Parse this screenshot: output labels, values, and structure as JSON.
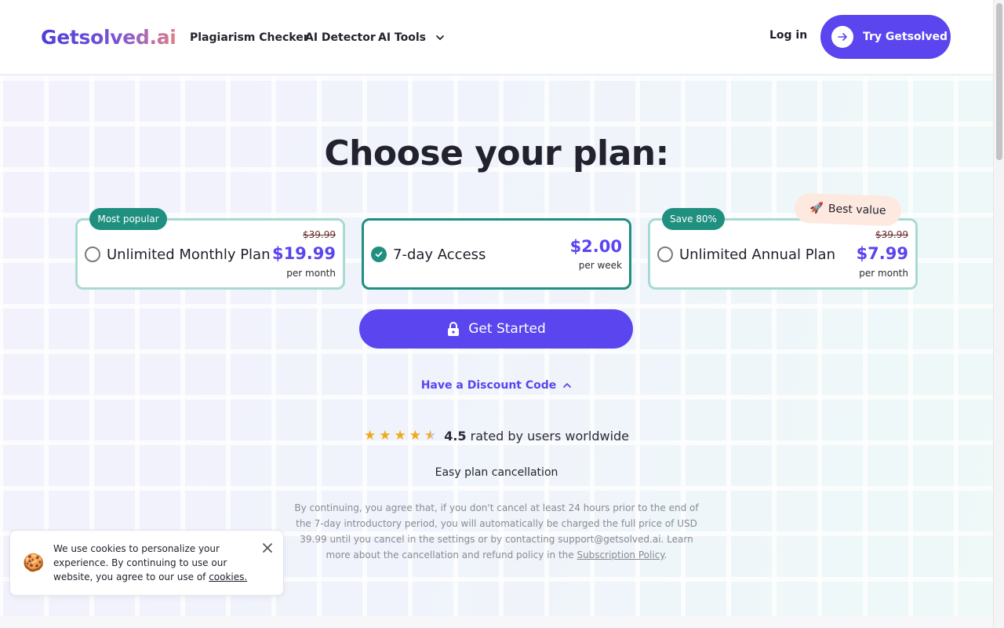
{
  "header": {
    "logo": "Getsolved.ai",
    "nav": [
      {
        "label": "Plagiarism Checker"
      },
      {
        "label": "AI Detector"
      },
      {
        "label": "AI Tools"
      }
    ],
    "login_label": "Log in",
    "try_label": "Try Getsolved"
  },
  "main": {
    "title": "Choose your plan:",
    "plans": [
      {
        "badge": "Most popular",
        "name": "Unlimited Monthly Plan",
        "old_price": "$39.99",
        "price": "$19.99",
        "period": "per month",
        "selected": false
      },
      {
        "name": "7-day Access",
        "price": "$2.00",
        "period": "per week",
        "selected": true
      },
      {
        "badge": "Save 80%",
        "name": "Unlimited Annual Plan",
        "old_price": "$39.99",
        "price": "$7.99",
        "period": "per month",
        "selected": false
      }
    ],
    "best_value": {
      "emoji": "🚀",
      "label": "Best value"
    },
    "cta_label": "Get Started",
    "discount_label": "Have a Discount Code",
    "rating": {
      "value": "4.5",
      "text": "rated by users worldwide",
      "stars": 4.5
    },
    "cancellation": "Easy plan cancellation",
    "legal_text": "By continuing, you agree that, if you don't cancel at least 24 hours prior to the end of the 7-day introductory period, you will automatically be charged the full price of USD 39.99 until you cancel in the settings or by contacting support@getsolved.ai. Learn more about the cancellation and refund policy in the ",
    "legal_link": "Subscription Policy",
    "legal_end": "."
  },
  "cookie": {
    "emoji": "🍪",
    "text": "We use cookies to personalize your experience. By continuing to use our website, you agree to our use of ",
    "link": "cookies."
  },
  "colors": {
    "accent": "#5a45ef",
    "teal": "#1f8f7f",
    "teal_light": "#a9dad2"
  }
}
